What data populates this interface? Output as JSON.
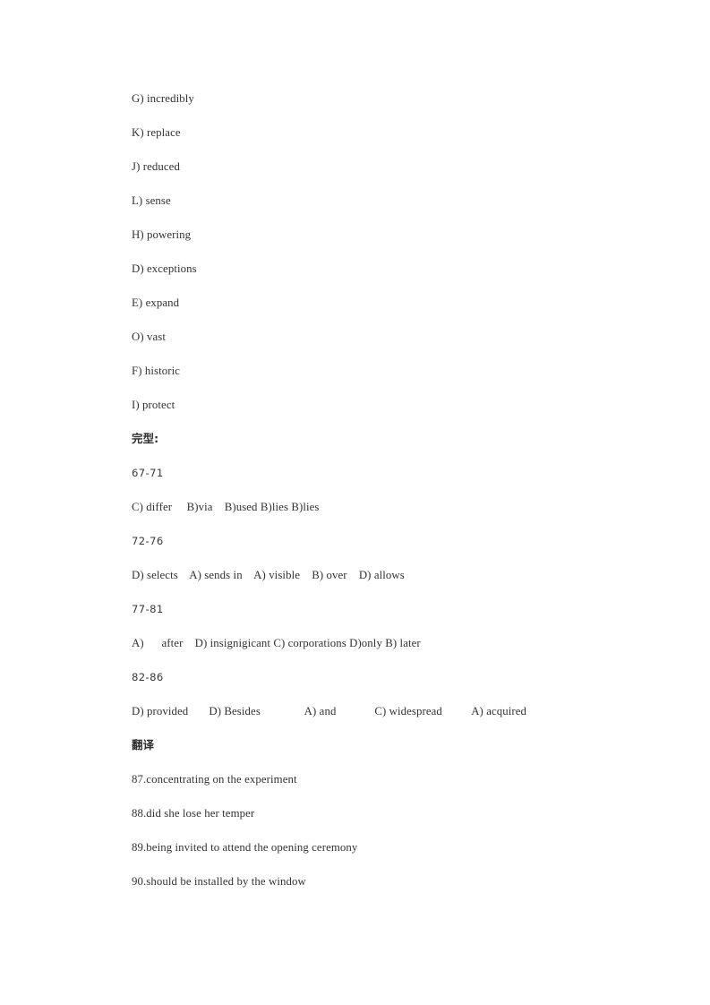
{
  "document": {
    "vocabulary_answers": [
      "G) incredibly",
      "K) replace",
      "J) reduced",
      "L) sense",
      "H) powering",
      "D) exceptions",
      "E) expand",
      "O) vast",
      "F) historic",
      "I) protect"
    ],
    "cloze_section": {
      "heading": "完型:",
      "groups": [
        {
          "range": "67-71",
          "answers": "C) differ     B)via    B)used B)lies B)lies"
        },
        {
          "range": "72-76",
          "answers": "D) selects    A) sends in    A) visible    B) over    D) allows"
        },
        {
          "range": "77-81",
          "answers": "A)      after    D) insignigicant C) corporations D)only B) later"
        },
        {
          "range": "82-86",
          "answers": "D) provided       D) Besides               A) and             C) widespread          A) acquired"
        }
      ]
    },
    "translation_section": {
      "heading": "翻译",
      "answers": [
        "87.concentrating on the experiment",
        "88.did she lose her temper",
        "89.being invited to attend the opening ceremony",
        "90.should be installed by the window"
      ]
    }
  }
}
